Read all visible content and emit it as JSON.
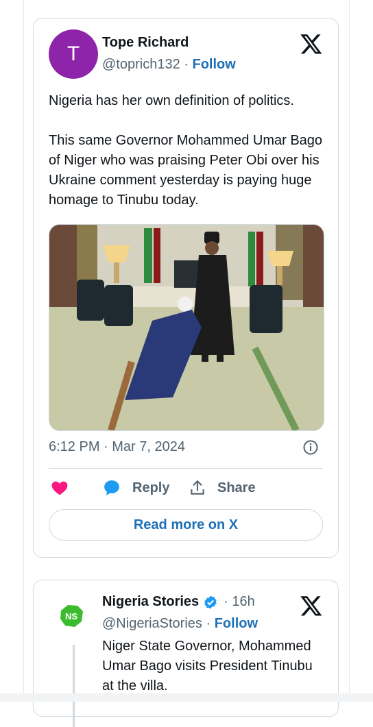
{
  "tweet1": {
    "avatar_letter": "T",
    "author_name": "Tope Richard",
    "handle": "@toprich132",
    "separator": " · ",
    "follow_label": "Follow",
    "text": "Nigeria has her own definition of politics.\n\nThis same Governor Mohammed Umar Bago of Niger who was praising Peter Obi over his Ukraine comment yesterday is paying huge homage to Tinubu today.",
    "timestamp": "6:12 PM · Mar 7, 2024",
    "reply_label": "Reply",
    "share_label": "Share",
    "read_more_label": "Read more on X"
  },
  "tweet2": {
    "author_name": "Nigeria Stories",
    "time": "· 16h",
    "handle": "@NigeriaStories",
    "separator": " · ",
    "follow_label": "Follow",
    "text": "Niger State Governor, Mohammed Umar Bago visits President Tinubu at the villa."
  },
  "colors": {
    "accent": "#1d70b8",
    "like": "#f91880",
    "avatar": "#8e24aa",
    "verified": "#1d9bf0"
  },
  "icons": [
    "x-logo-icon",
    "info-icon",
    "heart-icon",
    "reply-bubble-icon",
    "share-icon",
    "verified-badge-icon"
  ]
}
